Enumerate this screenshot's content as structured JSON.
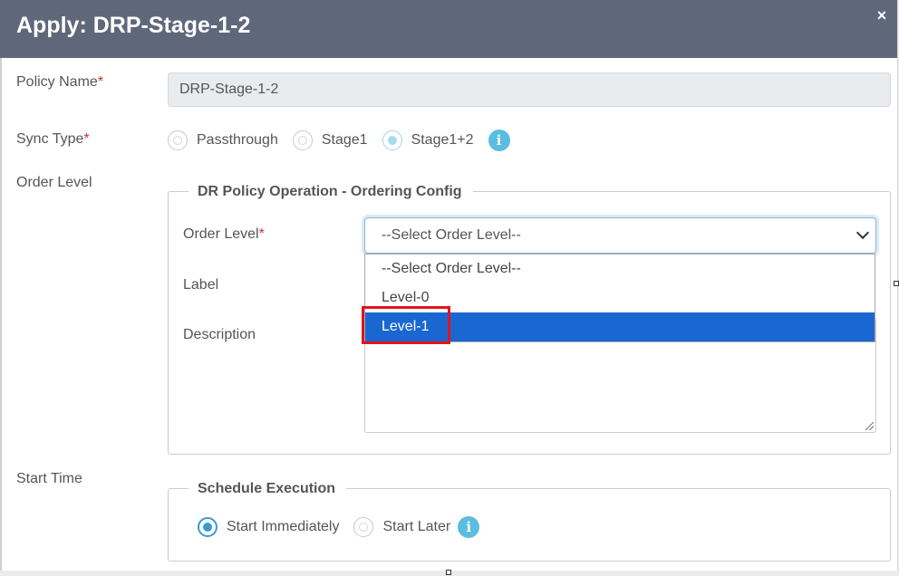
{
  "dialog": {
    "title": "Apply: DRP-Stage-1-2",
    "close_glyph": "×"
  },
  "form": {
    "policy_name": {
      "label": "Policy Name",
      "required_mark": "*",
      "value": "DRP-Stage-1-2"
    },
    "sync_type": {
      "label": "Sync Type",
      "required_mark": "*",
      "options": [
        "Passthrough",
        "Stage1",
        "Stage1+2"
      ],
      "selected": "Stage1+2",
      "info_glyph": "i"
    },
    "order_level_label": "Order Level",
    "start_time_label": "Start Time"
  },
  "ordering_config": {
    "legend": "DR Policy Operation - Ordering Config",
    "order_level": {
      "label": "Order Level",
      "required_mark": "*",
      "value": "--Select Order Level--"
    },
    "label_field": {
      "label": "Label"
    },
    "description": {
      "label": "Description"
    }
  },
  "dropdown": {
    "options": [
      "--Select Order Level--",
      "Level-0",
      "Level-1"
    ],
    "highlighted": "Level-1"
  },
  "schedule": {
    "legend": "Schedule Execution",
    "options": [
      "Start Immediately",
      "Start Later"
    ],
    "selected": "Start Immediately",
    "info_glyph": "i"
  },
  "colors": {
    "header_bg": "#5f677b",
    "dropdown_highlight": "#1a67d2",
    "annotation_red": "#e0141e",
    "info_blue": "#5bbde0"
  }
}
